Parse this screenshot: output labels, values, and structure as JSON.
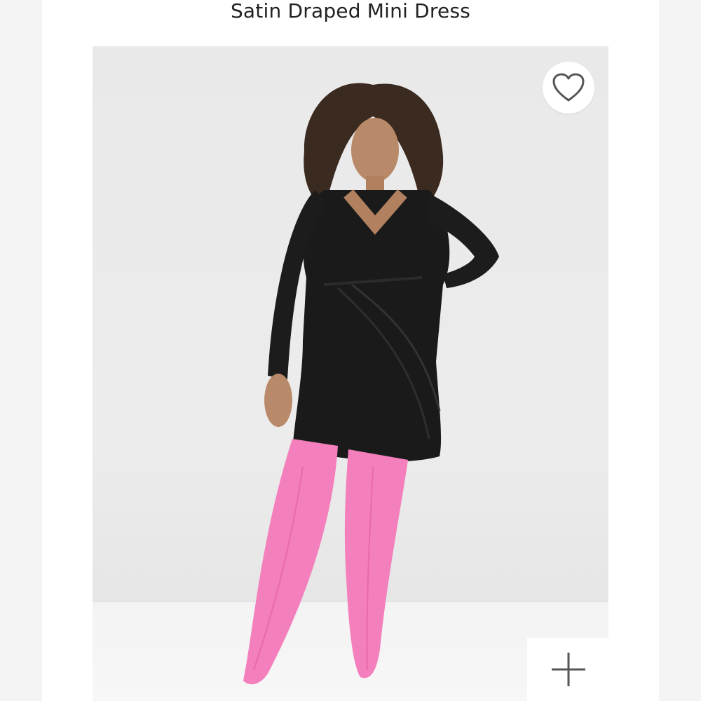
{
  "product": {
    "title": "Satin Draped Mini Dress"
  },
  "actions": {
    "wishlist_icon": "heart-outline-icon",
    "zoom_icon": "plus-icon"
  },
  "colors": {
    "background": "#ffffff",
    "title_text": "#222222",
    "icon_stroke": "#555555",
    "dress": "#1a1a1a",
    "boots": "#f47fbd"
  }
}
